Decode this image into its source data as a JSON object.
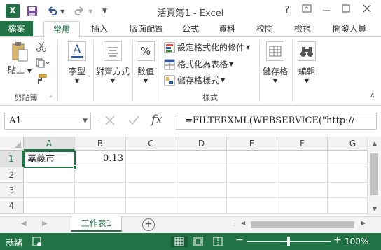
{
  "window": {
    "title": "活頁簿1 - Excel",
    "help_label": "?",
    "app_letter": "X"
  },
  "ribbon_tabs": [
    {
      "label": "檔案"
    },
    {
      "label": "常用"
    },
    {
      "label": "插入"
    },
    {
      "label": "版面配置"
    },
    {
      "label": "公式"
    },
    {
      "label": "資料"
    },
    {
      "label": "校閱"
    },
    {
      "label": "檢視"
    },
    {
      "label": "開發人員"
    }
  ],
  "ribbon": {
    "paste_label": "貼上",
    "clipboard_group": "剪貼簿",
    "font_label": "字型",
    "alignment_label": "對齊方式",
    "number_label": "數值",
    "number_icon": "%",
    "cond_format_label": "設定格式化的條件",
    "format_table_label": "格式化為表格",
    "cell_styles_label": "儲存格樣式",
    "styles_group": "樣式",
    "cells_label": "儲存格",
    "editing_label": "編輯"
  },
  "formula_bar": {
    "name_box": "A1",
    "fx_label": "fx",
    "formula": "=FILTERXML(WEBSERVICE(\"http://"
  },
  "grid": {
    "columns": [
      "A",
      "B",
      "C",
      "D",
      "E",
      "F",
      "G"
    ],
    "rows": [
      "1",
      "2",
      "3",
      "4"
    ],
    "cells": {
      "A1": "嘉義市",
      "B1": "0.13"
    }
  },
  "sheets": {
    "tabs": [
      "工作表1"
    ],
    "add_label": "+"
  },
  "status": {
    "mode": "就緒",
    "zoom": "100%",
    "zoom_minus": "−",
    "zoom_plus": "+"
  },
  "colors": {
    "accent": "#217346"
  }
}
